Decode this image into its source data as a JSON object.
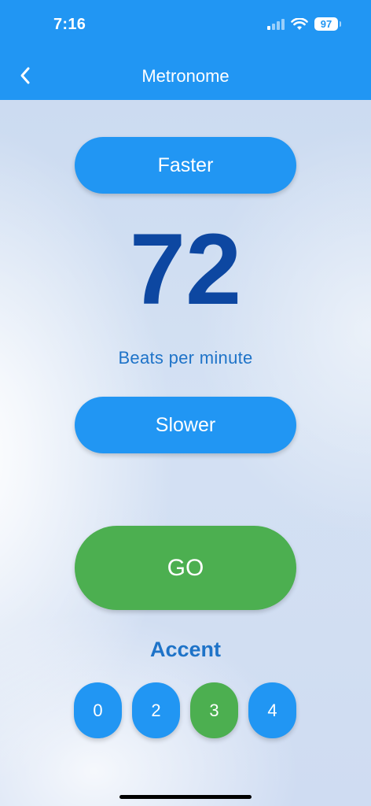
{
  "status_bar": {
    "time": "7:16",
    "battery": "97"
  },
  "app_bar": {
    "title": "Metronome",
    "back_icon": "chevron-left-icon",
    "color": "#2196f3"
  },
  "controls": {
    "faster_label": "Faster",
    "slower_label": "Slower",
    "bpm_value": "72",
    "bpm_label": "Beats per minute",
    "go_label": "GO"
  },
  "accent": {
    "title": "Accent",
    "options": [
      "0",
      "2",
      "3",
      "4"
    ],
    "selected": "3"
  },
  "colors": {
    "primary": "#2196f3",
    "go": "#4caf50",
    "bpm_text": "#0d47a1",
    "label_text": "#1e73c8"
  }
}
